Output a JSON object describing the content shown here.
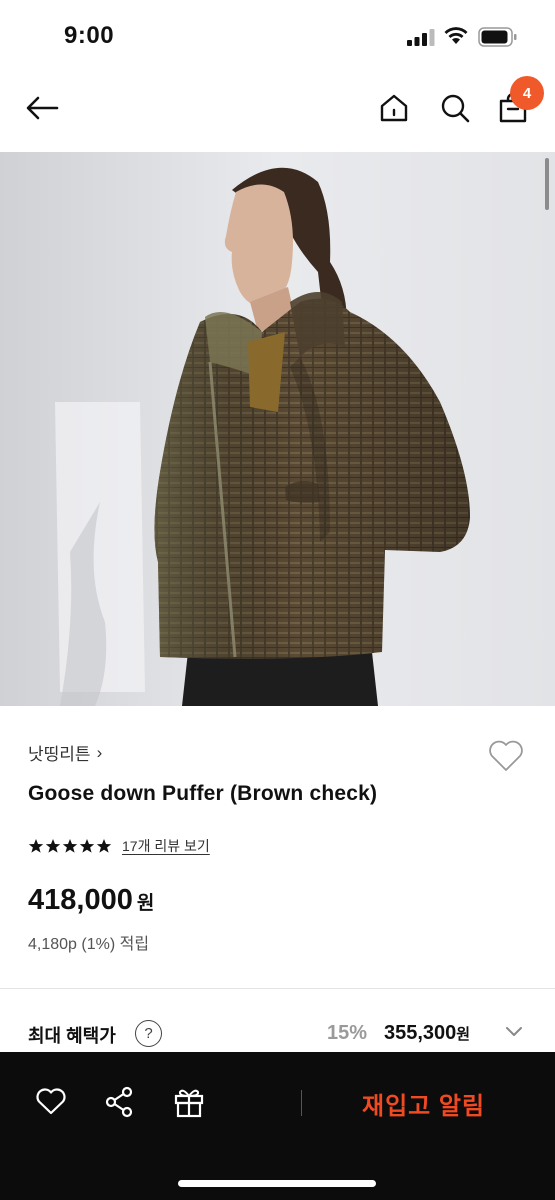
{
  "status_bar": {
    "time": "9:00"
  },
  "nav": {
    "cart_count": "4"
  },
  "product": {
    "brand": "낫띵리튼",
    "brand_chevron": "›",
    "title": "Goose down Puffer (Brown check)",
    "rating_stars": 5,
    "review_link": "17개 리뷰 보기",
    "price": "418,000",
    "currency": "원",
    "points": "4,180p (1%) 적립"
  },
  "benefit": {
    "label": "최대 혜택가",
    "help": "?",
    "discount": "15%",
    "price": "355,300",
    "currency": "원"
  },
  "bottom_bar": {
    "restock_label": "재입고 알림"
  },
  "colors": {
    "accent": "#f05a2a",
    "restock_text": "#f04a22",
    "bottom_bar_bg": "#0c0c0c"
  },
  "icons": [
    "back-arrow-icon",
    "home-icon",
    "search-icon",
    "shopping-bag-icon",
    "heart-icon",
    "share-icon",
    "gift-icon",
    "chevron-down-icon",
    "star-icon"
  ]
}
